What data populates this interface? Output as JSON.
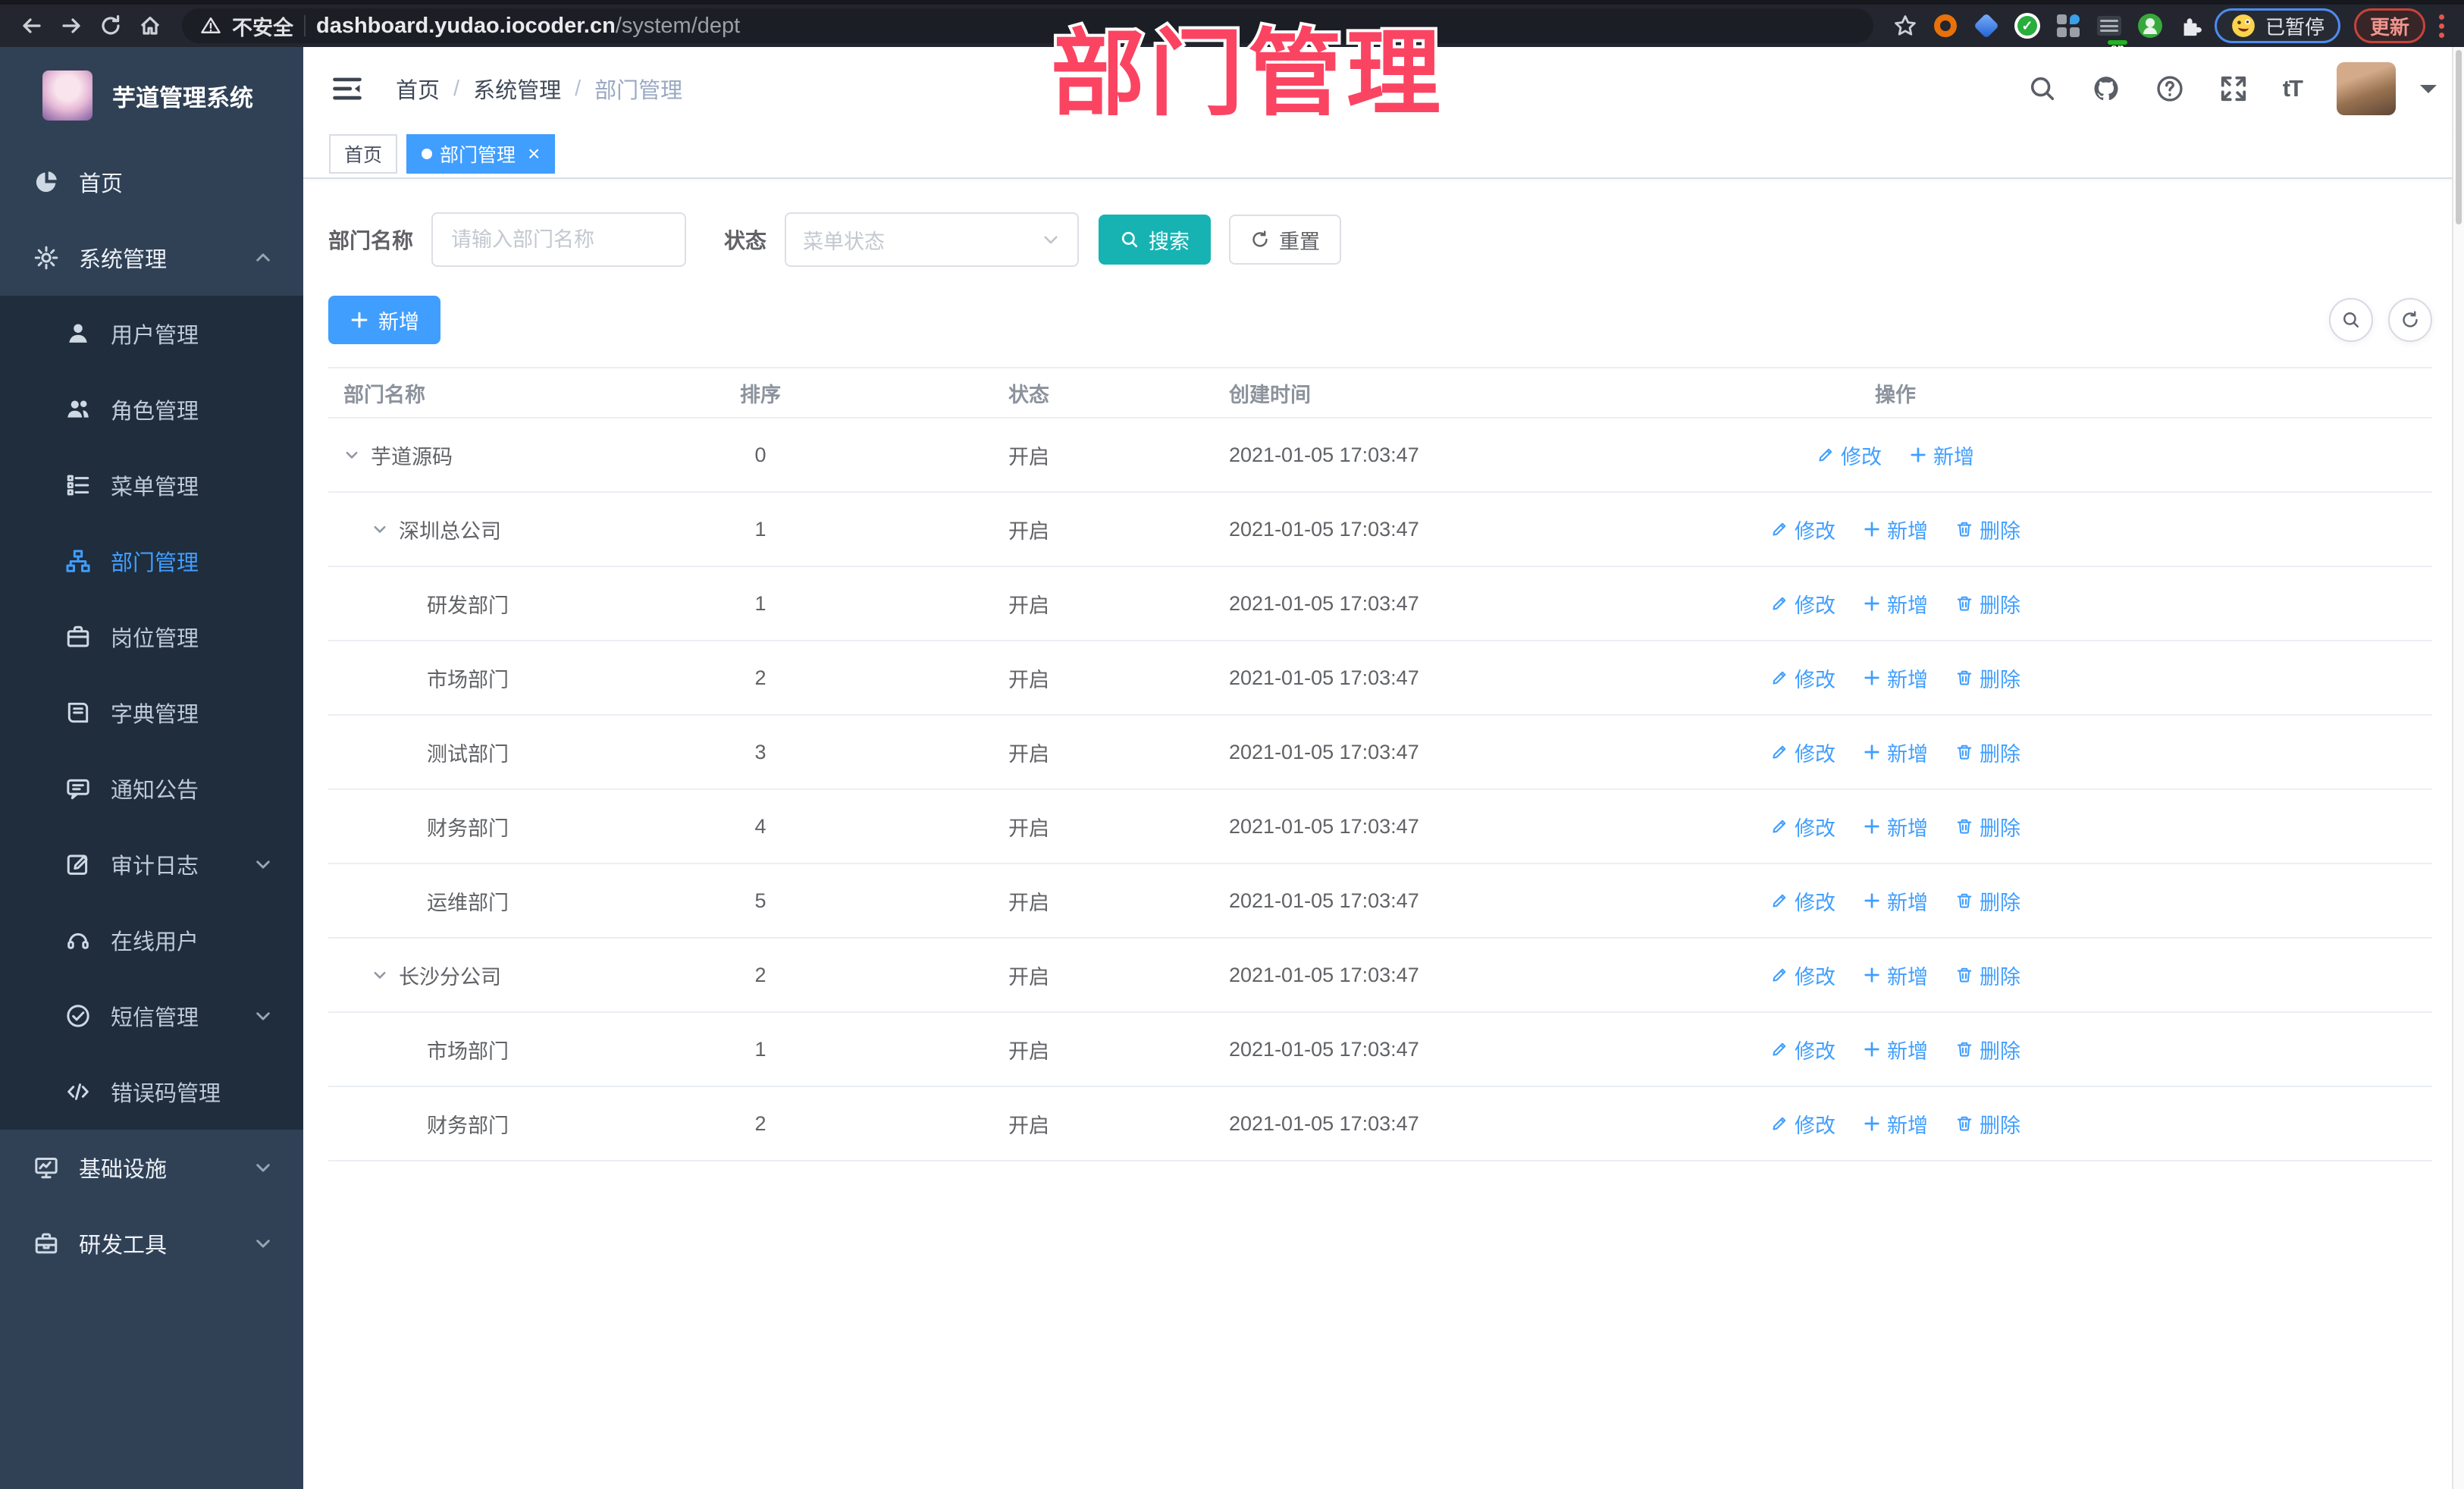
{
  "colors": {
    "primary": "#409eff",
    "search-btn": "#17b3b3",
    "overlay": "#fb4462",
    "sidebar-bg": "#304156",
    "submenu-bg": "#1f2d3d",
    "chrome-bg": "#23262e"
  },
  "browser": {
    "security_label": "不安全",
    "url_host": "dashboard.yudao.iocoder.cn",
    "url_path": "/system/dept",
    "profile_status": "已暂停",
    "update_label": "更新"
  },
  "overlay": {
    "title": "部门管理"
  },
  "sidebar": {
    "logo_title": "芋道管理系统",
    "items": [
      {
        "key": "home",
        "label": "首页",
        "icon": "dashboard-icon",
        "level": 0
      },
      {
        "key": "system",
        "label": "系统管理",
        "icon": "gear-icon",
        "level": 0,
        "chevron": "up"
      },
      {
        "key": "user",
        "label": "用户管理",
        "icon": "user-icon",
        "level": 1
      },
      {
        "key": "role",
        "label": "角色管理",
        "icon": "users-icon",
        "level": 1
      },
      {
        "key": "menu",
        "label": "菜单管理",
        "icon": "menu-list-icon",
        "level": 1
      },
      {
        "key": "dept",
        "label": "部门管理",
        "icon": "org-tree-icon",
        "level": 1,
        "active": true
      },
      {
        "key": "post",
        "label": "岗位管理",
        "icon": "badge-icon",
        "level": 1
      },
      {
        "key": "dict",
        "label": "字典管理",
        "icon": "book-icon",
        "level": 1
      },
      {
        "key": "notice",
        "label": "通知公告",
        "icon": "announcement-icon",
        "level": 1
      },
      {
        "key": "audit",
        "label": "审计日志",
        "icon": "audit-log-icon",
        "level": 1,
        "chevron": "down"
      },
      {
        "key": "online",
        "label": "在线用户",
        "icon": "headset-icon",
        "level": 1
      },
      {
        "key": "sms",
        "label": "短信管理",
        "icon": "sms-icon",
        "level": 1,
        "chevron": "down"
      },
      {
        "key": "errcode",
        "label": "错误码管理",
        "icon": "code-icon",
        "level": 1
      },
      {
        "key": "infra",
        "label": "基础设施",
        "icon": "monitor-icon",
        "level": 0,
        "chevron": "down"
      },
      {
        "key": "tools",
        "label": "研发工具",
        "icon": "toolbox-icon",
        "level": 0,
        "chevron": "down"
      }
    ]
  },
  "header": {
    "breadcrumb": [
      "首页",
      "系统管理",
      "部门管理"
    ],
    "tags": [
      {
        "label": "首页",
        "active": false,
        "closable": false
      },
      {
        "label": "部门管理",
        "active": true,
        "closable": true
      }
    ]
  },
  "filters": {
    "dept_name_label": "部门名称",
    "dept_name_placeholder": "请输入部门名称",
    "dept_name_value": "",
    "status_label": "状态",
    "status_placeholder": "菜单状态",
    "search_label": "搜索",
    "reset_label": "重置"
  },
  "toolbar": {
    "add_label": "新增"
  },
  "table": {
    "columns": [
      "部门名称",
      "排序",
      "状态",
      "创建时间",
      "操作"
    ],
    "rows": [
      {
        "name": "芋道源码",
        "level": 0,
        "expand": true,
        "sort": "0",
        "status": "开启",
        "created": "2021-01-05 17:03:47",
        "actions": [
          "修改",
          "新增"
        ]
      },
      {
        "name": "深圳总公司",
        "level": 1,
        "expand": true,
        "sort": "1",
        "status": "开启",
        "created": "2021-01-05 17:03:47",
        "actions": [
          "修改",
          "新增",
          "删除"
        ]
      },
      {
        "name": "研发部门",
        "level": 2,
        "expand": false,
        "sort": "1",
        "status": "开启",
        "created": "2021-01-05 17:03:47",
        "actions": [
          "修改",
          "新增",
          "删除"
        ]
      },
      {
        "name": "市场部门",
        "level": 2,
        "expand": false,
        "sort": "2",
        "status": "开启",
        "created": "2021-01-05 17:03:47",
        "actions": [
          "修改",
          "新增",
          "删除"
        ]
      },
      {
        "name": "测试部门",
        "level": 2,
        "expand": false,
        "sort": "3",
        "status": "开启",
        "created": "2021-01-05 17:03:47",
        "actions": [
          "修改",
          "新增",
          "删除"
        ]
      },
      {
        "name": "财务部门",
        "level": 2,
        "expand": false,
        "sort": "4",
        "status": "开启",
        "created": "2021-01-05 17:03:47",
        "actions": [
          "修改",
          "新增",
          "删除"
        ]
      },
      {
        "name": "运维部门",
        "level": 2,
        "expand": false,
        "sort": "5",
        "status": "开启",
        "created": "2021-01-05 17:03:47",
        "actions": [
          "修改",
          "新增",
          "删除"
        ]
      },
      {
        "name": "长沙分公司",
        "level": 1,
        "expand": true,
        "sort": "2",
        "status": "开启",
        "created": "2021-01-05 17:03:47",
        "actions": [
          "修改",
          "新增",
          "删除"
        ]
      },
      {
        "name": "市场部门",
        "level": 2,
        "expand": false,
        "sort": "1",
        "status": "开启",
        "created": "2021-01-05 17:03:47",
        "actions": [
          "修改",
          "新增",
          "删除"
        ]
      },
      {
        "name": "财务部门",
        "level": 2,
        "expand": false,
        "sort": "2",
        "status": "开启",
        "created": "2021-01-05 17:03:47",
        "actions": [
          "修改",
          "新增",
          "删除"
        ]
      }
    ]
  }
}
